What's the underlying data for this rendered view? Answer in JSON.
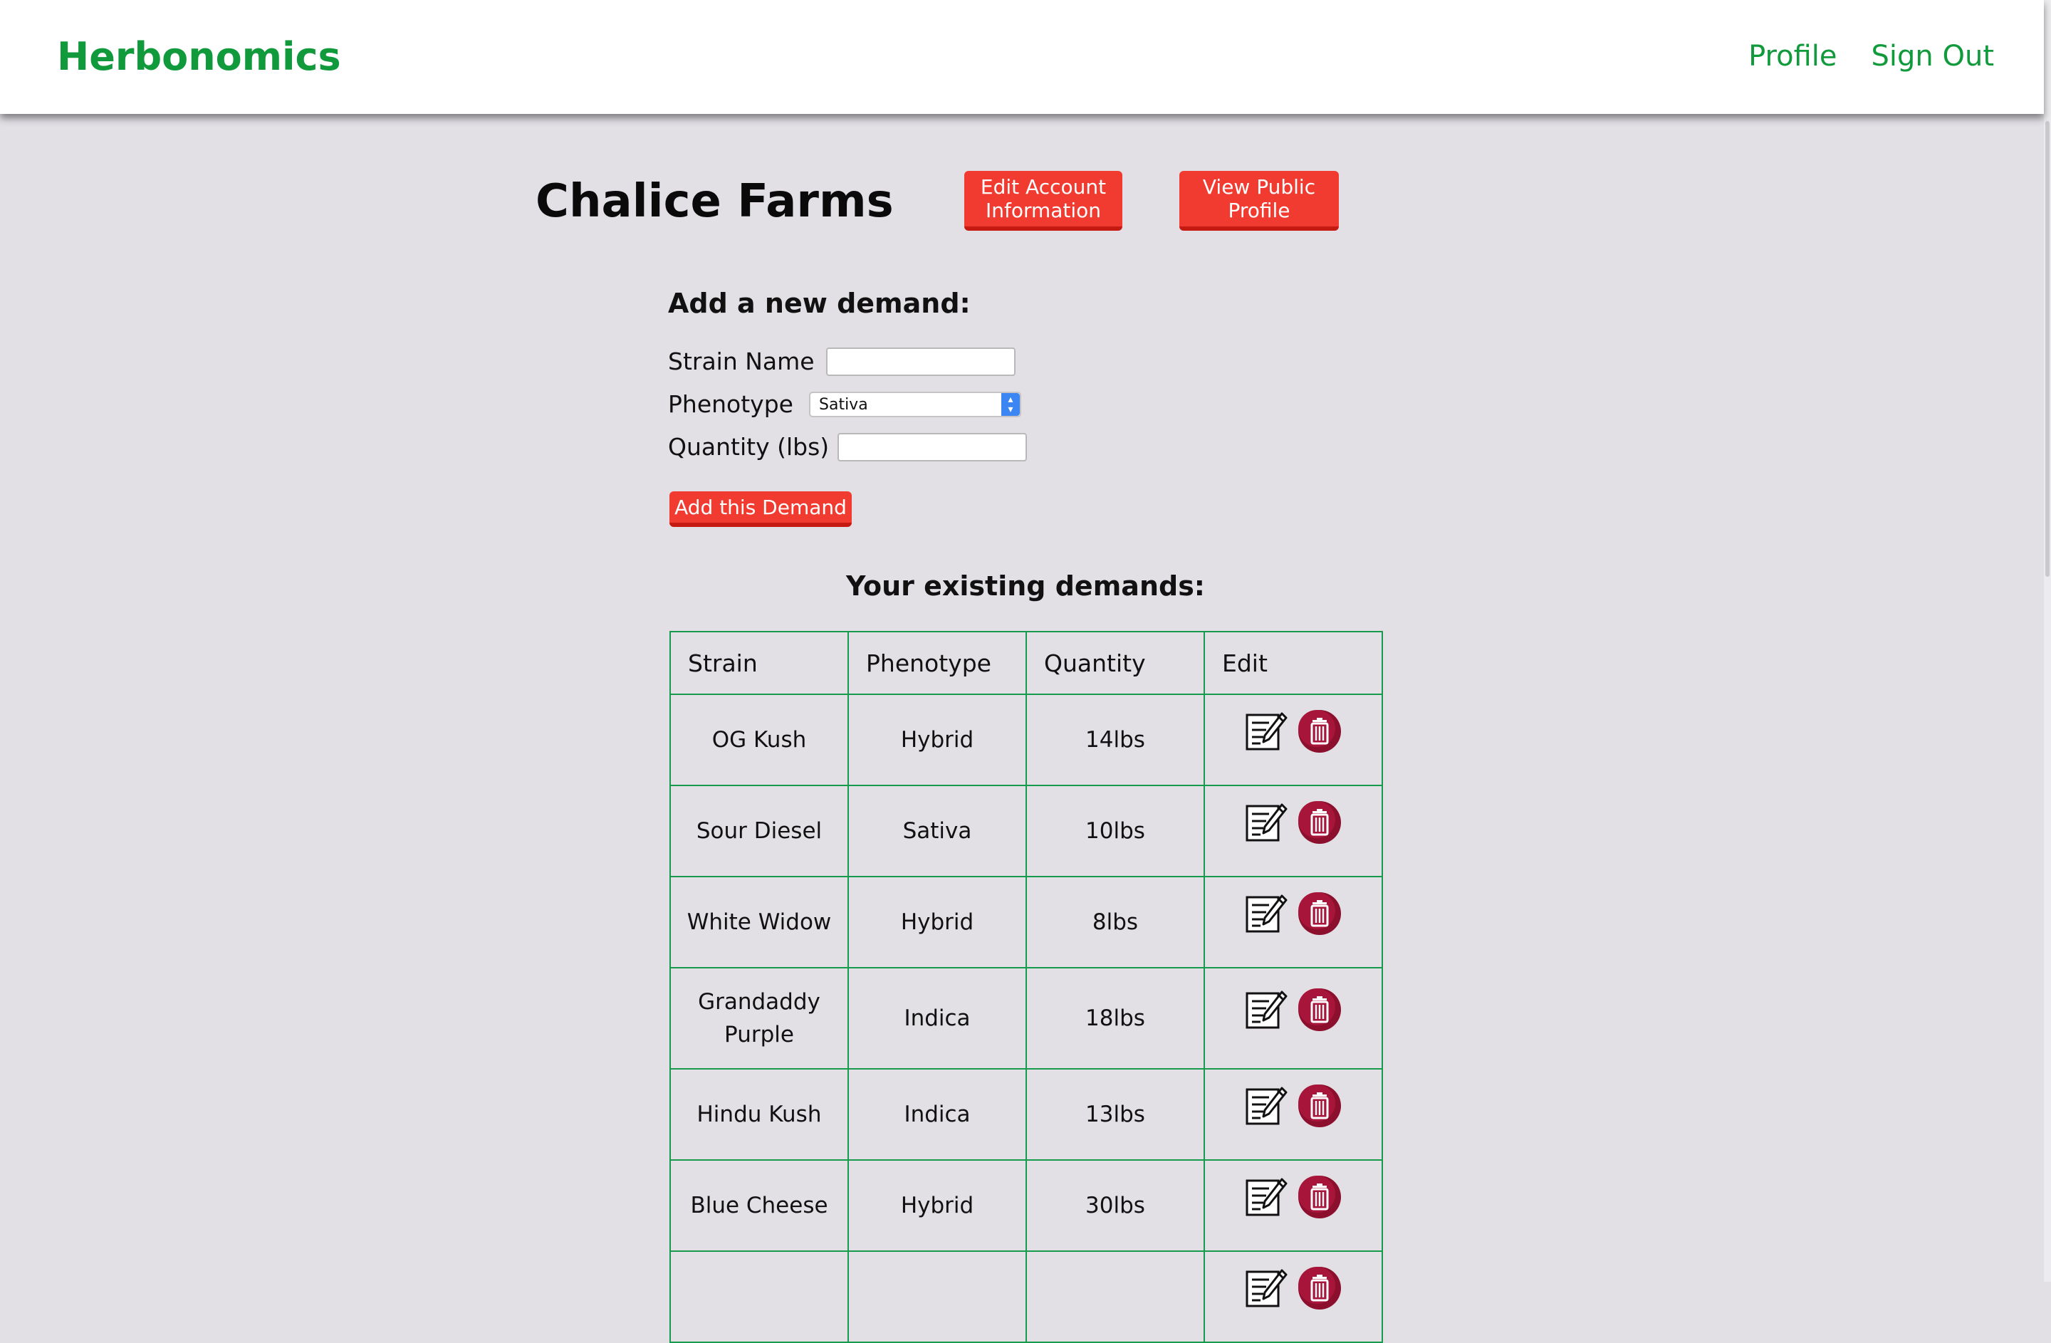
{
  "nav": {
    "brand": "Herbonomics",
    "links": [
      "Profile",
      "Sign Out"
    ]
  },
  "header": {
    "title": "Chalice Farms",
    "edit_account_label": "Edit Account Information",
    "view_profile_label": "View Public Profile"
  },
  "form": {
    "title": "Add a new demand:",
    "strain_label": "Strain Name",
    "strain_value": "",
    "phenotype_label": "Phenotype",
    "phenotype_selected": "Sativa",
    "quantity_label": "Quantity (lbs)",
    "quantity_value": "",
    "submit_label": "Add this Demand"
  },
  "table": {
    "title": "Your existing demands:",
    "headers": [
      "Strain",
      "Phenotype",
      "Quantity",
      "Edit"
    ],
    "rows": [
      {
        "strain": "OG Kush",
        "phenotype": "Hybrid",
        "quantity": "14lbs"
      },
      {
        "strain": "Sour Diesel",
        "phenotype": "Sativa",
        "quantity": "10lbs"
      },
      {
        "strain": "White Widow",
        "phenotype": "Hybrid",
        "quantity": "8lbs"
      },
      {
        "strain": "Grandaddy Purple",
        "phenotype": "Indica",
        "quantity": "18lbs"
      },
      {
        "strain": "Hindu Kush",
        "phenotype": "Indica",
        "quantity": "13lbs"
      },
      {
        "strain": "Blue Cheese",
        "phenotype": "Hybrid",
        "quantity": "30lbs"
      },
      {
        "strain": "",
        "phenotype": "",
        "quantity": ""
      }
    ]
  },
  "icons": {
    "edit": "edit-icon",
    "delete": "trash-icon"
  },
  "colors": {
    "brand": "#109a3c",
    "button": "#f13b30",
    "table_border": "#169a4b",
    "delete_icon": "#8c0f2e",
    "background": "#e2e0e5"
  }
}
